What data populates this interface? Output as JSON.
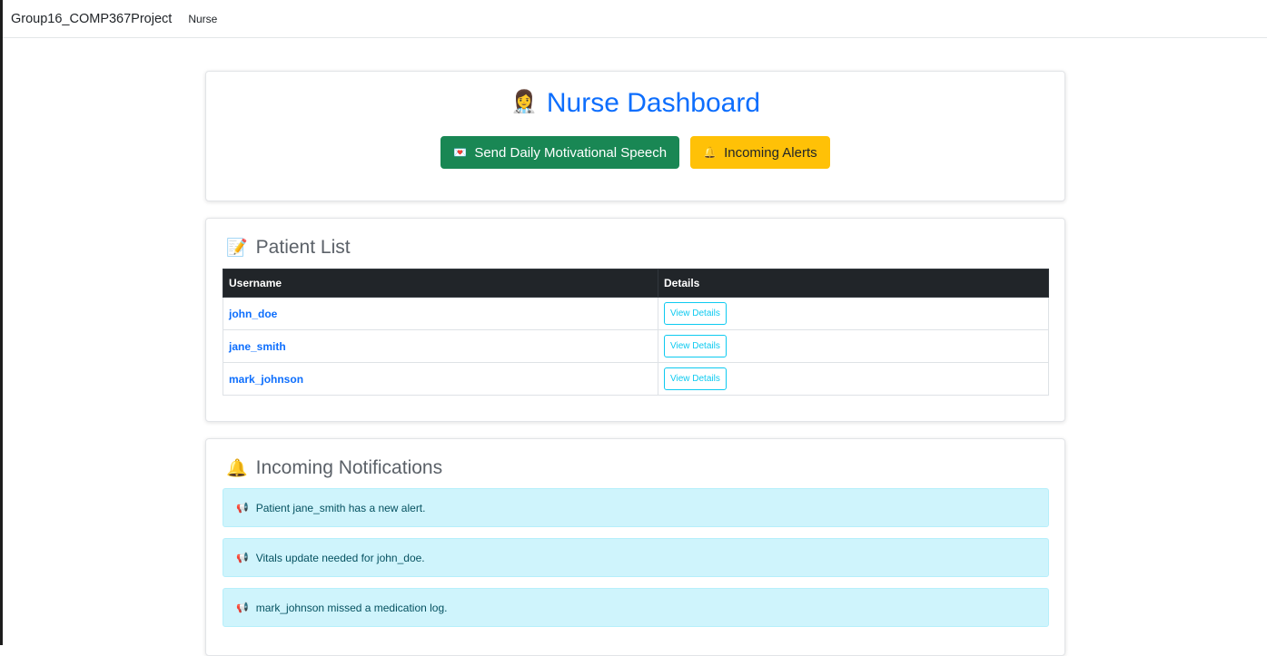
{
  "navbar": {
    "brand": "Group16_COMP367Project",
    "link": "Nurse"
  },
  "header": {
    "title_icon": "👩‍⚕️",
    "title": "Nurse Dashboard",
    "motivation_icon": "💌",
    "motivation_button": "Send Daily Motivational Speech",
    "alerts_icon": "🔔",
    "alerts_button": "Incoming Alerts",
    "colors": {
      "title": "#0d6efd",
      "green": "#198754",
      "yellow": "#ffc107"
    }
  },
  "patients": {
    "icon": "📝",
    "title": "Patient List",
    "columns": [
      "Username",
      "Details"
    ],
    "rows": [
      {
        "username": "john_doe",
        "action": "View Details"
      },
      {
        "username": "jane_smith",
        "action": "View Details"
      },
      {
        "username": "mark_johnson",
        "action": "View Details"
      }
    ]
  },
  "notifications": {
    "icon": "🔔",
    "title": "Incoming Notifications",
    "item_icon": "📢",
    "items": [
      "Patient jane_smith has a new alert.",
      "Vitals update needed for john_doe.",
      "mark_johnson missed a medication log."
    ]
  }
}
